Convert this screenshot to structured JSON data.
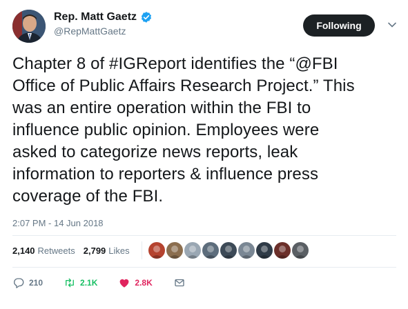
{
  "author": {
    "name": "Rep. Matt Gaetz",
    "handle": "@RepMattGaetz"
  },
  "follow_label": "Following",
  "tweet": {
    "lines": [
      "Chapter 8 of #IGReport identifies the “@FBI",
      "Office of Public Affairs Research Project.” This",
      "was an entire operation within the FBI to",
      "influence public opinion. Employees were",
      "asked to categorize news reports, leak",
      "information to reporters & influence press",
      "coverage of the FBI."
    ],
    "timestamp": "2:07 PM - 14 Jun 2018"
  },
  "stats": {
    "retweets_count": "2,140",
    "retweets_label": "Retweets",
    "likes_count": "2,799",
    "likes_label": "Likes"
  },
  "likers": [
    "#b5432f",
    "#8b6e4f",
    "#9aa7b3",
    "#5d6d7c",
    "#3d4a57",
    "#7a8794",
    "#2f3b47",
    "#6b2f2a",
    "#5a5f64"
  ],
  "actions": {
    "replies": "210",
    "retweets": "2.1K",
    "likes": "2.8K"
  },
  "colors": {
    "retweet_green": "#17bf63",
    "like_red": "#e0245e",
    "verified_blue": "#1da1f2"
  }
}
